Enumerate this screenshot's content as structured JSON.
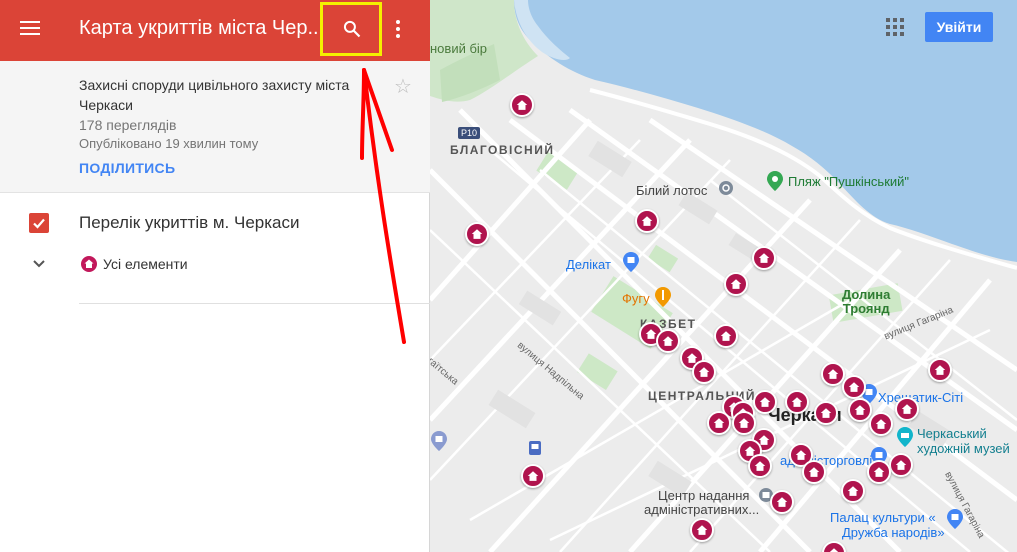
{
  "header": {
    "title": "Карта укриттів міста Чер...",
    "icons": {
      "menu": "menu-icon",
      "search": "search-icon",
      "more": "more-vert-icon"
    }
  },
  "info": {
    "description": "Захисні споруди цивільного захисту міста Черкаси",
    "views": "178 переглядів",
    "published": "Опубліковано 19 хвилин тому",
    "share_label": "ПОДІЛИТИСЬ"
  },
  "layer": {
    "title": "Перелік укриттів м. Черкаси",
    "checked": true,
    "item_label": "Усі елементи"
  },
  "map": {
    "login_label": "Увійти",
    "labels": {
      "forest": "новий бір",
      "road": "Р10",
      "district_blagovisnyi": "БЛАГОВІСНИЙ",
      "bilyi_lotos": "Білий лотос",
      "beach": "Пляж \"Пушкінський\"",
      "delikat": "Делікат",
      "fugu": "Фугу",
      "kazbet": "КАЗБЕТ",
      "dolyna_troyand_1": "Долина",
      "dolyna_troyand_2": "Троянд",
      "street_nadpilna": "вулиця Надпільна",
      "street_gagarina_top": "вулиця Гагаріна",
      "street_left": "агаїтська",
      "district_centralnyi": "ЦЕНТРАЛЬНИЙ",
      "city": "Черкаси",
      "khreshchatyk": "Хрещатик-Сіті",
      "museum_1": "Черкаський",
      "museum_2": "художній музей",
      "trade": "адміністорговлі",
      "cnap_1": "Центр надання",
      "cnap_2": "адміністративних...",
      "street_gagarina_right": "вулиця Гагаріна",
      "palace_1": "Палац культури «",
      "palace_2": "Дружба народів»"
    }
  },
  "colors": {
    "header_red": "#db4437",
    "highlight_yellow": "#f4f000",
    "accent_blue": "#4285f4",
    "pin_magenta": "#b0144e",
    "water": "#a3c9ea",
    "annotation_arrow": "#ff0000"
  }
}
